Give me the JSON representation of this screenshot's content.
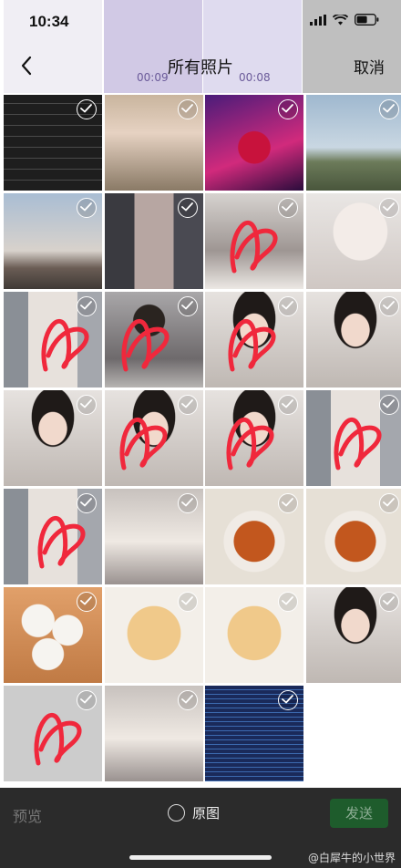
{
  "status": {
    "time": "10:34"
  },
  "nav": {
    "title": "所有照片",
    "cancel": "取消"
  },
  "top_strip": {
    "durations": [
      "00:09",
      "00:08"
    ]
  },
  "bottom": {
    "preview": "预览",
    "original": "原图",
    "send": "发送"
  },
  "watermark": "@白犀牛的小世界",
  "colors": {
    "bottom_bar": "#2b2b2b",
    "send_bg": "#1e5c2c",
    "scribble": "#f0283c"
  },
  "photos": [
    {
      "kind": "screenshot-text",
      "scribble": false
    },
    {
      "kind": "woman-street",
      "scribble": false
    },
    {
      "kind": "woman-red-dress-stage",
      "scribble": false
    },
    {
      "kind": "sky-buildings",
      "scribble": false
    },
    {
      "kind": "sunset-crane",
      "scribble": false
    },
    {
      "kind": "balcony-window",
      "scribble": false
    },
    {
      "kind": "mirror-selfie-doorway",
      "scribble": true
    },
    {
      "kind": "selfie-white-top",
      "scribble": false
    },
    {
      "kind": "selfie-shop",
      "scribble": true
    },
    {
      "kind": "selfie-phone-mirror",
      "scribble": true
    },
    {
      "kind": "selfie-closeup",
      "scribble": true
    },
    {
      "kind": "selfie-closeup",
      "scribble": false
    },
    {
      "kind": "selfie-closeup",
      "scribble": false
    },
    {
      "kind": "selfie-closeup",
      "scribble": true
    },
    {
      "kind": "selfie-closeup",
      "scribble": true
    },
    {
      "kind": "selfie-shop",
      "scribble": true
    },
    {
      "kind": "selfie-shop",
      "scribble": true
    },
    {
      "kind": "mirror-floral-dress",
      "scribble": false
    },
    {
      "kind": "noodles-plate",
      "scribble": false
    },
    {
      "kind": "noodles-plate",
      "scribble": false
    },
    {
      "kind": "steamed-buns",
      "scribble": false
    },
    {
      "kind": "pastry-bread",
      "scribble": false
    },
    {
      "kind": "pastry-bread",
      "scribble": false
    },
    {
      "kind": "selfie-closeup",
      "scribble": false
    },
    {
      "kind": "mirror-selfie-phone",
      "scribble": true
    },
    {
      "kind": "mirror-floral-dress",
      "scribble": false
    },
    {
      "kind": "airport-board",
      "scribble": false
    }
  ]
}
